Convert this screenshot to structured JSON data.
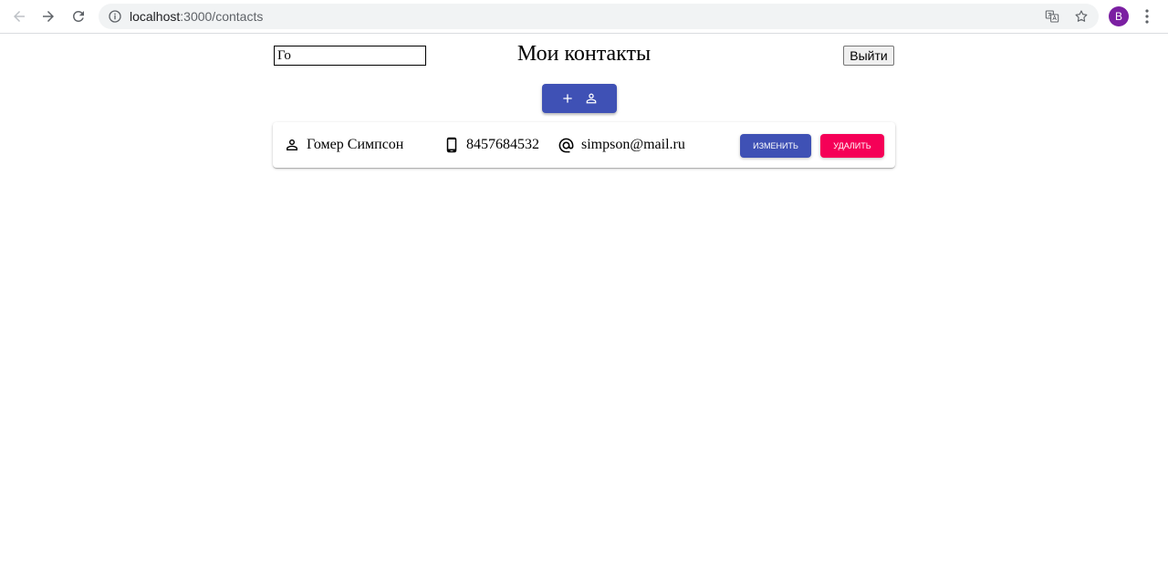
{
  "browser": {
    "url_host": "localhost",
    "url_path": ":3000/contacts",
    "profile_initial": "B",
    "profile_color": "#7b1fa2"
  },
  "header": {
    "search_value": "Го",
    "title": "Мои контакты",
    "logout_label": "Выйти"
  },
  "add_button": {
    "icons": [
      "plus-icon",
      "person-icon"
    ],
    "color": "#3f51b5"
  },
  "contacts": [
    {
      "name": "Гомер Симпсон",
      "phone": "8457684532",
      "email": "simpson@mail.ru",
      "edit_label": "ИЗМЕНИТЬ",
      "delete_label": "УДАЛИТЬ"
    }
  ],
  "colors": {
    "primary": "#3f51b5",
    "secondary": "#f50057"
  }
}
